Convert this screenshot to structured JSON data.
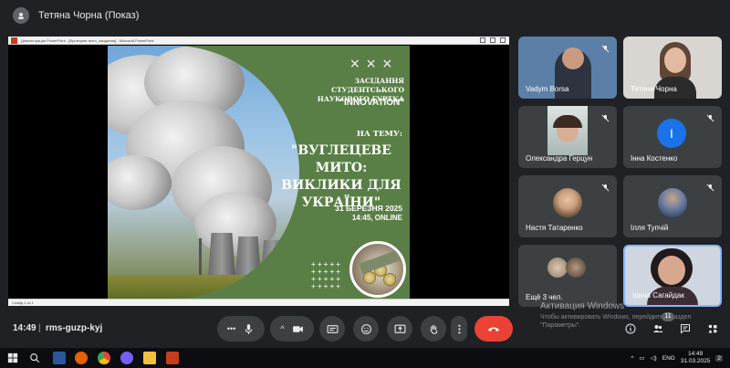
{
  "header": {
    "presenter": "Тетяна Чорна (Показ)"
  },
  "powerpoint": {
    "window_title": "Демонстрация PowerPoint - [Вуглецеве мито_засідання] - Microsoft PowerPoint",
    "status": "Слайд 1 из 1"
  },
  "slide": {
    "marks": "×××",
    "heading": "ЗАСІДАННЯ СТУДЕНТСЬКОГО НАУКОВОГО ГУРТКА",
    "name": "\"INNOVATION\"",
    "theme": "НА ТЕМУ:",
    "title": "\"ВУГЛЕЦЕВЕ МИТО: ВИКЛИКИ ДЛЯ УКРАЇНИ\"",
    "date": "31 БЕРЕЗНЯ 2025",
    "time": "14:45, ONLINE",
    "plus_grid": "+++++\n+++++\n+++++\n+++++"
  },
  "participants": [
    {
      "name": "Vadym Borsa",
      "muted": true
    },
    {
      "name": "Тетяна Чорна",
      "muted": false
    },
    {
      "name": "Олександра Герцун",
      "muted": true
    },
    {
      "name": "Інна Костенко",
      "muted": true,
      "initial": "І",
      "color": "#1a73e8"
    },
    {
      "name": "Настя Татаренко",
      "muted": true
    },
    {
      "name": "Ілля Тупчій",
      "muted": true
    },
    {
      "name": "Ещё 3 чел.",
      "muted": false
    },
    {
      "name": "Ірина Сагайдак",
      "muted": false
    }
  ],
  "bottom": {
    "time": "14:49",
    "separator": "|",
    "meeting_code": "rms-guzp-kyj",
    "participants_count": "11"
  },
  "watermark": {
    "title": "Активация Windows",
    "text": "Чтобы активировать Windows, перейдите в раздел \"Параметры\"."
  },
  "taskbar": {
    "lang": "ENG",
    "clock_time": "14:49",
    "clock_date": "31.03.2025",
    "notif": "2"
  },
  "colors": {
    "background": "#202124",
    "tile": "#3c4043",
    "end_call": "#ea4335",
    "slide_green": "#597f46"
  }
}
